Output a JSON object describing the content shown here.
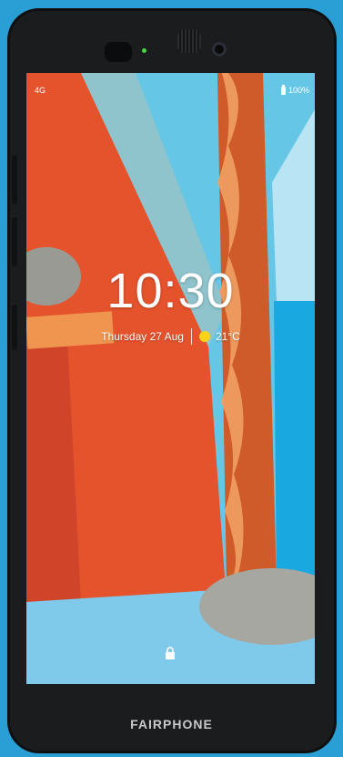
{
  "colors": {
    "page_bg": "#2a9fd6",
    "wallpaper_orange": "#e5532d",
    "wallpaper_blue": "#66c6e6",
    "sky_blue": "#1aa8e0",
    "stripe_orange": "#cf5b2a",
    "led_green": "#3fdc3f"
  },
  "status_bar": {
    "network": "4G",
    "battery": "100%"
  },
  "lock_screen": {
    "time": "10:30",
    "date": "Thursday 27 Aug",
    "temperature": "21°C",
    "weather_icon": "sun-icon",
    "lock_icon": "lock-icon"
  },
  "brand": "FAIRPHONE"
}
